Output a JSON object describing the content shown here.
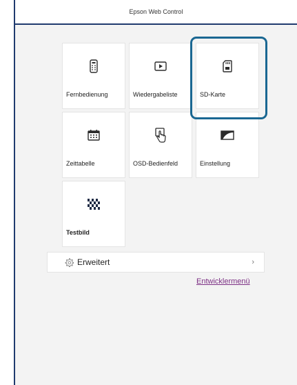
{
  "header": {
    "title": "Epson Web Control"
  },
  "tiles": [
    {
      "label": "Fernbedienung",
      "icon": "remote-control-icon"
    },
    {
      "label": "Wiedergabeliste",
      "icon": "play-icon"
    },
    {
      "label": "SD-Karte",
      "icon": "sd-card-icon",
      "highlighted": true
    },
    {
      "label": "Zeittabelle",
      "icon": "calendar-icon"
    },
    {
      "label": "OSD-Bedienfeld",
      "icon": "touch-hand-icon"
    },
    {
      "label": "Einstellung",
      "icon": "screen-icon"
    },
    {
      "label": "Testbild",
      "icon": "test-pattern-icon"
    }
  ],
  "advanced": {
    "label": "Erweitert",
    "icon": "gear-icon",
    "chevron": "›"
  },
  "developer_link": "Entwicklermenü",
  "colors": {
    "header_rule": "#1f3a6e",
    "highlight_border": "#1a6792",
    "link": "#7b2e83"
  }
}
